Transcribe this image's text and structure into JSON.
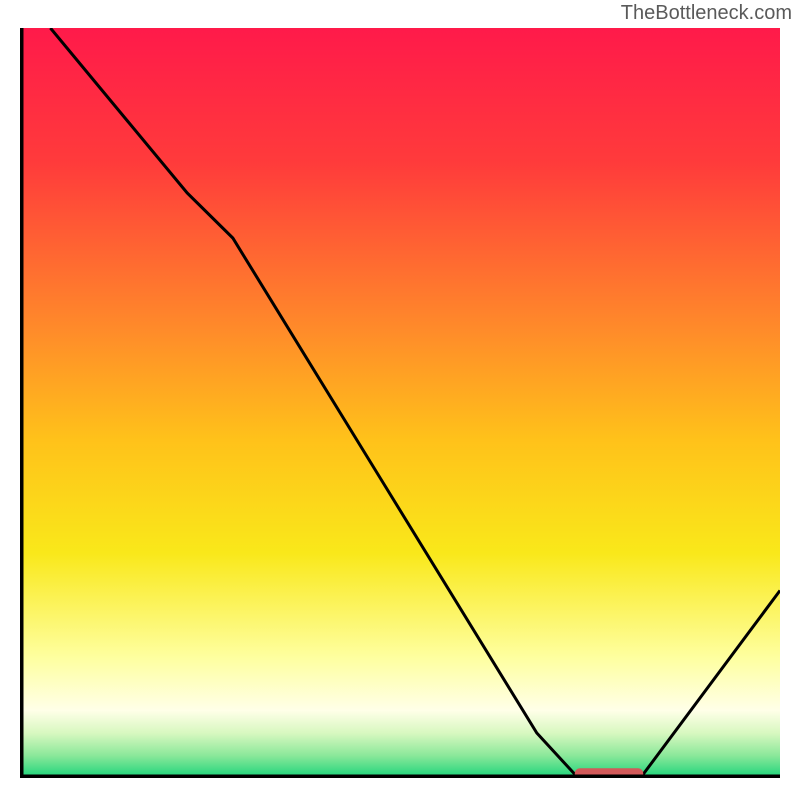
{
  "watermark": "TheBottleneck.com",
  "chart_data": {
    "type": "line",
    "title": "",
    "xlabel": "",
    "ylabel": "",
    "xlim": [
      0,
      100
    ],
    "ylim": [
      0,
      100
    ],
    "gradient": {
      "stops": [
        {
          "offset": 0,
          "color": "#ff1a4a"
        },
        {
          "offset": 18,
          "color": "#ff3b3b"
        },
        {
          "offset": 40,
          "color": "#ff8a2a"
        },
        {
          "offset": 55,
          "color": "#ffc21a"
        },
        {
          "offset": 70,
          "color": "#f9e81a"
        },
        {
          "offset": 84,
          "color": "#feffa0"
        },
        {
          "offset": 91,
          "color": "#ffffe8"
        },
        {
          "offset": 94,
          "color": "#d8f8c0"
        },
        {
          "offset": 97,
          "color": "#8be89a"
        },
        {
          "offset": 100,
          "color": "#1ad47a"
        }
      ]
    },
    "curve": [
      {
        "x": 4,
        "y": 100
      },
      {
        "x": 22,
        "y": 78
      },
      {
        "x": 28,
        "y": 72
      },
      {
        "x": 68,
        "y": 6
      },
      {
        "x": 73,
        "y": 0.5
      },
      {
        "x": 82,
        "y": 0.5
      },
      {
        "x": 100,
        "y": 25
      }
    ],
    "minimum_marker": {
      "x_start": 73,
      "x_end": 82,
      "y": 0.5,
      "color": "#d25a5a"
    }
  }
}
